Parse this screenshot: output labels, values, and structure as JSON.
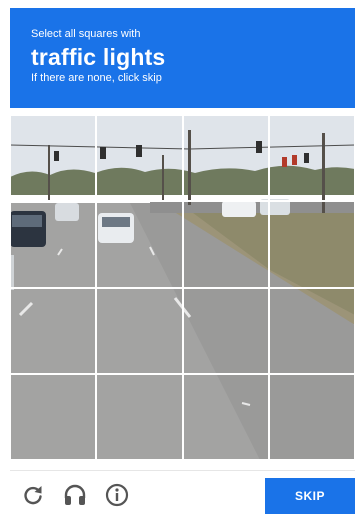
{
  "header": {
    "instruction": "Select all squares with",
    "target": "traffic lights",
    "hint": "If there are none, click skip"
  },
  "grid": {
    "rows": 4,
    "columns": 4,
    "tile_count": 16
  },
  "footer": {
    "reload_icon": "reload-icon",
    "audio_icon": "headphones-icon",
    "info_icon": "info-icon",
    "skip_label": "SKIP"
  },
  "colors": {
    "accent": "#1a73e8",
    "header_text": "#ffffff",
    "icon": "#555555"
  }
}
